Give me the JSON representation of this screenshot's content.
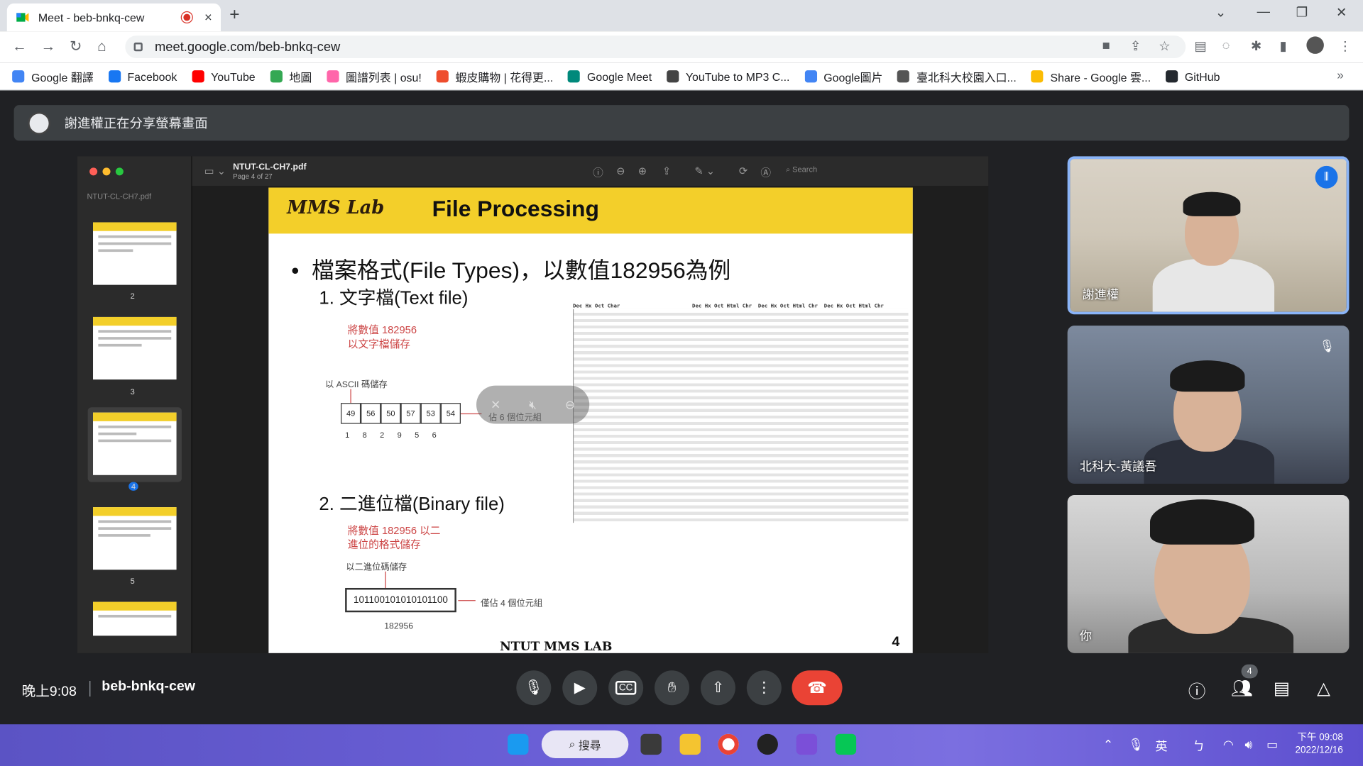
{
  "browser": {
    "tab_title": "Meet - beb-bnkq-cew",
    "close_icon": "×",
    "new_tab_icon": "+",
    "url": "meet.google.com/beb-bnkq-cew",
    "bookmarks": [
      {
        "label": "Google 翻譯",
        "color": "#4285f4"
      },
      {
        "label": "Facebook",
        "color": "#1877f2"
      },
      {
        "label": "YouTube",
        "color": "#ff0000"
      },
      {
        "label": "地圖",
        "color": "#34a853"
      },
      {
        "label": "圖譜列表 | osu!",
        "color": "#ff66aa"
      },
      {
        "label": "蝦皮購物 | 花得更...",
        "color": "#ee4d2d"
      },
      {
        "label": "Google Meet",
        "color": "#00897b"
      },
      {
        "label": "YouTube to MP3 C...",
        "color": "#444444"
      },
      {
        "label": "Google圖片",
        "color": "#4285f4"
      },
      {
        "label": "臺北科大校園入口...",
        "color": "#555555"
      },
      {
        "label": "Share - Google 雲...",
        "color": "#fbbc04"
      },
      {
        "label": "GitHub",
        "color": "#24292f"
      }
    ],
    "more": "»"
  },
  "meet": {
    "presenting_banner": "謝進權正在分享螢幕畫面",
    "meeting_time": "晚上9:08",
    "meeting_code": "beb-bnkq-cew",
    "participant_count": "4",
    "participants": [
      {
        "name": "謝進權"
      },
      {
        "name": "北科大-黃議吾"
      },
      {
        "name": "你"
      }
    ]
  },
  "preview": {
    "file_name": "NTUT-CL-CH7.pdf",
    "page_info": "Page 4 of 27",
    "search_placeholder": "Search",
    "thumbnails": [
      {
        "num": "2"
      },
      {
        "num": "3"
      },
      {
        "num": "4"
      },
      {
        "num": "5"
      }
    ]
  },
  "slide": {
    "logo": "MMS Lab",
    "title": "File Processing",
    "bullet": "檔案格式(File Types)，以數值182956為例",
    "section1": "1.   文字檔(Text file)",
    "note1": "將數值 182956\n以文字檔儲存",
    "ascii_label": "以 ASCII 碼儲存",
    "ascii_cells": [
      "49",
      "56",
      "50",
      "57",
      "53",
      "54"
    ],
    "ascii_digits": [
      "1",
      "8",
      "2",
      "9",
      "5",
      "6"
    ],
    "ascii_note": "佔 6 個位元組",
    "section2": "2.   二進位檔(Binary file)",
    "note2": "將數值 182956 以二\n進位的格式儲存",
    "binary_label": "以二進位碼儲存",
    "binary_value": "101100101010101100",
    "binary_note": "僅佔 4 個位元組",
    "binary_caption": "182956",
    "footer": "NTUT MMS LAB",
    "page_number": "4",
    "table_header": "Dec Hx Oct Char                       Dec Hx Oct Html Chr  Dec Hx Oct Html Chr  Dec Hx Oct Html Chr"
  },
  "taskbar": {
    "search_label": "搜尋",
    "ime": "英",
    "ime2": "ㄅ",
    "time": "下午 09:08",
    "date": "2022/12/16"
  }
}
